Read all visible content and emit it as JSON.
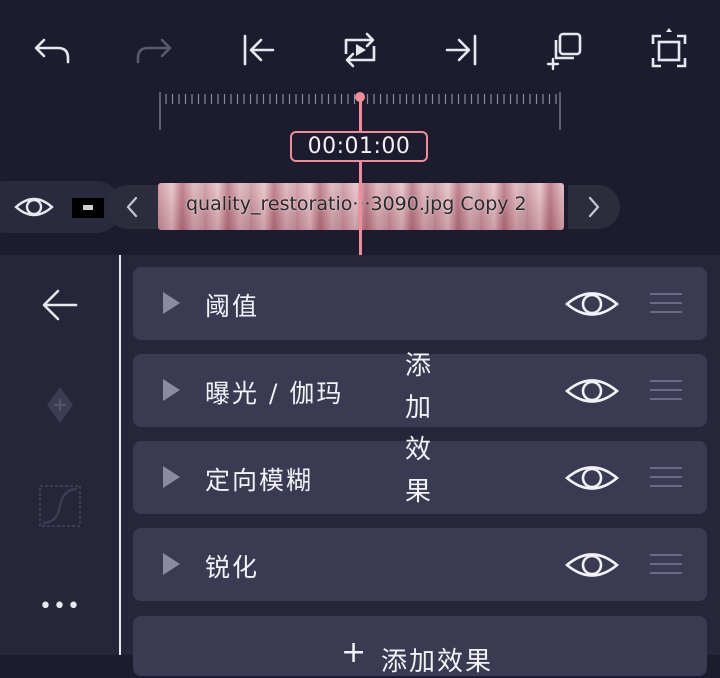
{
  "toolbar": {
    "undo_icon": "undo-icon",
    "redo_icon": "redo-icon",
    "jump_start_icon": "jump-to-start-icon",
    "loop_play_icon": "loop-play-icon",
    "jump_end_icon": "jump-to-end-icon",
    "add_layer_icon": "add-layer-icon",
    "fullscreen_icon": "fullscreen-icon"
  },
  "timeline": {
    "timecode": "00:01:00",
    "clip_label": "quality_restoratio···3090.jpg Copy 2"
  },
  "sidebar": {
    "back_icon": "back-arrow-icon",
    "keyframe_icon": "add-keyframe-icon",
    "curve_icon": "curve-icon",
    "more_label": "•••"
  },
  "effects": [
    {
      "name": "阈值"
    },
    {
      "name": "曝光 / 伽玛"
    },
    {
      "name": "定向模糊"
    },
    {
      "name": "锐化"
    }
  ],
  "add_effect_label": "添加效果",
  "tooltip_chars": [
    "添",
    "加",
    "效",
    "果"
  ],
  "colors": {
    "background": "#1c1c2e",
    "panel": "#26263a",
    "card": "#3a3a52",
    "accent": "#f08c9c"
  }
}
